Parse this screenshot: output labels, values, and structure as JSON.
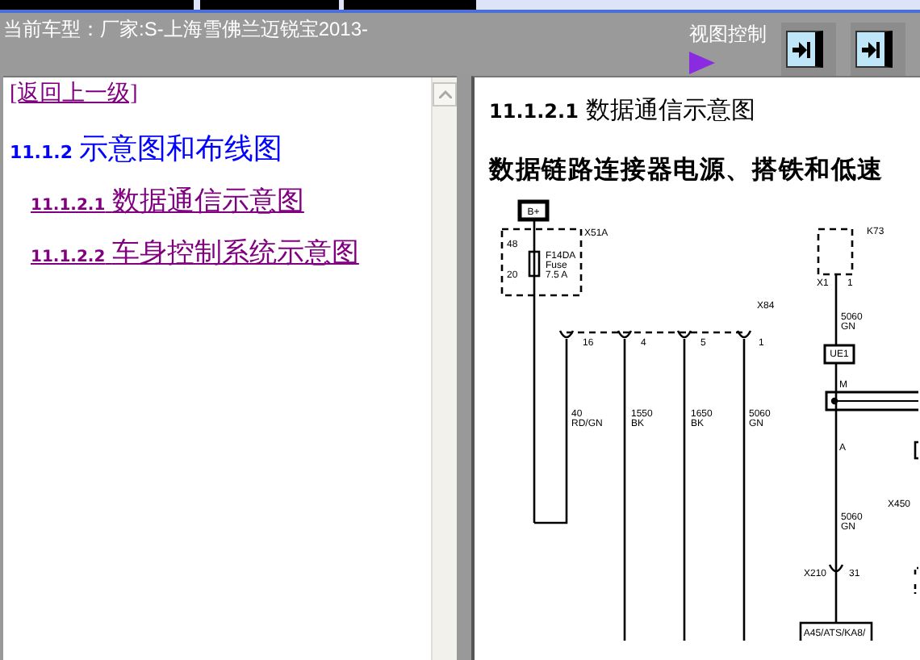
{
  "header": {
    "vehicle": "当前车型：厂家:S-上海雪佛兰迈锐宝2013-",
    "view_control_label": "视图控制"
  },
  "nav": {
    "back_link": "[返回上一级]",
    "section": {
      "number": "11.1.2",
      "title": "示意图和布线图"
    },
    "links": [
      {
        "number": "11.1.2.1",
        "title": "数据通信示意图"
      },
      {
        "number": "11.1.2.2",
        "title": "车身控制系统示意图"
      }
    ]
  },
  "content": {
    "heading": {
      "number": "11.1.2.1",
      "title": "数据通信示意图"
    },
    "subheading": "数据链路连接器电源、搭铁和低速",
    "diagram": {
      "labels": [
        "B+",
        "X51A",
        "F14DA",
        "Fuse",
        "7.5 A",
        "48",
        "20",
        "K73",
        "X1",
        "1",
        "X84",
        "16",
        "4",
        "5",
        "1",
        "40",
        "RD/GN",
        "1550",
        "BK",
        "1650",
        "BK",
        "5060",
        "GN",
        "5060",
        "GN",
        "UE1",
        "M",
        "A",
        "5060",
        "GN",
        "X210",
        "31",
        "A45/ATS/KA8/",
        "X450"
      ]
    }
  }
}
